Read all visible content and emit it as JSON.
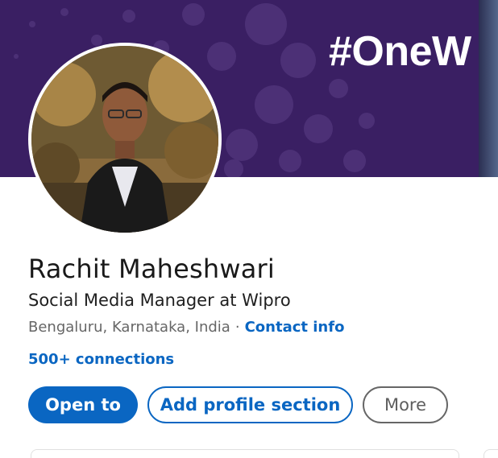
{
  "banner": {
    "hashtag": "#OneW",
    "background_color": "#3a1f63"
  },
  "profile": {
    "name": "Rachit Maheshwari",
    "headline": "Social Media Manager at Wipro",
    "location": "Bengaluru, Karnataka, India",
    "separator": "·",
    "contact_info_label": "Contact info",
    "connections_label": "500+ connections"
  },
  "actions": {
    "open_to_label": "Open to",
    "add_profile_section_label": "Add profile section",
    "more_label": "More"
  },
  "colors": {
    "primary_blue": "#0a66c2",
    "text_dark": "#191919",
    "text_muted": "#666666"
  }
}
